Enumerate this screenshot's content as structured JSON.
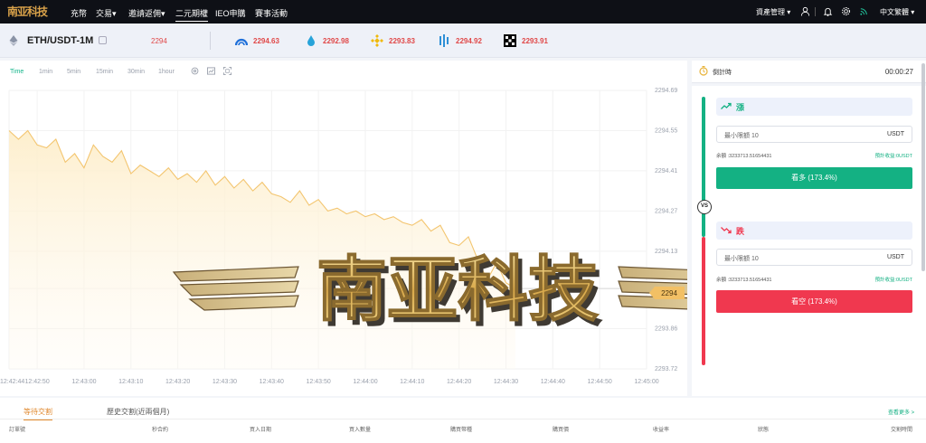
{
  "topbar": {
    "logo": "南亚科技",
    "nav": [
      {
        "label": "充幣"
      },
      {
        "label": "交易▾"
      },
      {
        "label": "邀請返佣▾"
      },
      {
        "label": "二元期權"
      },
      {
        "label": "IEO申購"
      },
      {
        "label": "賽事活動"
      }
    ],
    "asset_label": "資產管理",
    "language": "中文繁體"
  },
  "ticker": {
    "pair": "ETH/USDT-1M",
    "price": "2294",
    "exchanges": [
      {
        "icon": "bars-icon",
        "price": "2294.63"
      },
      {
        "icon": "drop-icon",
        "price": "2292.98"
      },
      {
        "icon": "binance-icon",
        "price": "2293.83"
      },
      {
        "icon": "columns-icon",
        "price": "2294.92"
      },
      {
        "icon": "okx-icon",
        "price": "2293.91"
      }
    ]
  },
  "chart": {
    "timeframes": [
      "Time",
      "1min",
      "5min",
      "15min",
      "30min",
      "1hour"
    ],
    "active_timeframe": "Time",
    "current_price_tag": "2294",
    "watermark": "南亚科技"
  },
  "chart_data": {
    "type": "area",
    "x_ticks": [
      "12:42:44",
      "12:42:50",
      "12:43:00",
      "12:43:10",
      "12:43:20",
      "12:43:30",
      "12:43:40",
      "12:43:50",
      "12:44:00",
      "12:44:10",
      "12:44:20",
      "12:44:30",
      "12:44:40",
      "12:44:50",
      "12:45:00"
    ],
    "y_ticks": [
      "2294.69",
      "2294.55",
      "2294.41",
      "2294.27",
      "2294.13",
      "2294",
      "2293.86",
      "2293.72"
    ],
    "ylim": [
      2293.72,
      2294.69
    ],
    "x": [
      "12:42:44",
      "12:42:46",
      "12:42:48",
      "12:42:50",
      "12:42:52",
      "12:42:54",
      "12:42:56",
      "12:42:58",
      "12:43:00",
      "12:43:02",
      "12:43:04",
      "12:43:06",
      "12:43:08",
      "12:43:10",
      "12:43:12",
      "12:43:14",
      "12:43:16",
      "12:43:18",
      "12:43:20",
      "12:43:22",
      "12:43:24",
      "12:43:26",
      "12:43:28",
      "12:43:30",
      "12:43:32",
      "12:43:34",
      "12:43:36",
      "12:43:38",
      "12:43:40",
      "12:43:42",
      "12:43:44",
      "12:43:46",
      "12:43:48",
      "12:43:50",
      "12:43:52",
      "12:43:54",
      "12:43:56",
      "12:43:58",
      "12:44:00",
      "12:44:02",
      "12:44:04",
      "12:44:06",
      "12:44:08",
      "12:44:10",
      "12:44:12",
      "12:44:14",
      "12:44:16",
      "12:44:18",
      "12:44:20",
      "12:44:22",
      "12:44:24",
      "12:44:26",
      "12:44:28",
      "12:44:30",
      "12:44:32"
    ],
    "values": [
      2294.55,
      2294.52,
      2294.55,
      2294.5,
      2294.49,
      2294.52,
      2294.44,
      2294.47,
      2294.42,
      2294.5,
      2294.46,
      2294.44,
      2294.48,
      2294.4,
      2294.43,
      2294.41,
      2294.39,
      2294.42,
      2294.38,
      2294.4,
      2294.37,
      2294.41,
      2294.36,
      2294.39,
      2294.35,
      2294.38,
      2294.34,
      2294.37,
      2294.33,
      2294.32,
      2294.3,
      2294.34,
      2294.29,
      2294.31,
      2294.27,
      2294.28,
      2294.26,
      2294.27,
      2294.25,
      2294.26,
      2294.24,
      2294.25,
      2294.23,
      2294.22,
      2294.24,
      2294.2,
      2294.22,
      2294.16,
      2294.15,
      2294.18,
      2294.1,
      2294.03,
      2294.09,
      2294.02,
      2294.0
    ]
  },
  "timer": {
    "label": "倒計時",
    "value": "00:00:27"
  },
  "trade": {
    "up": {
      "label": "漲",
      "input_placeholder": "最小限額 10",
      "unit": "USDT",
      "balance": "余額 :3233713.51654431",
      "expected": "預計收益:0USDT",
      "button": "看多 (173.4%)",
      "color": "#14b183"
    },
    "vs": "VS",
    "down": {
      "label": "跌",
      "input_placeholder": "最小限額 10",
      "unit": "USDT",
      "balance": "余額 :3233713.51654431",
      "expected": "預計收益:0USDT",
      "button": "看空 (173.4%)",
      "color": "#f0384f"
    }
  },
  "bottom": {
    "tabs": [
      "等待交割",
      "歷史交割(近兩個月)"
    ],
    "more": "查看更多 >",
    "columns": [
      "訂單號",
      "秒合約",
      "買入日期",
      "買入數量",
      "購買幣種",
      "購買價",
      "收益率",
      "狀態",
      "交割時間"
    ]
  }
}
